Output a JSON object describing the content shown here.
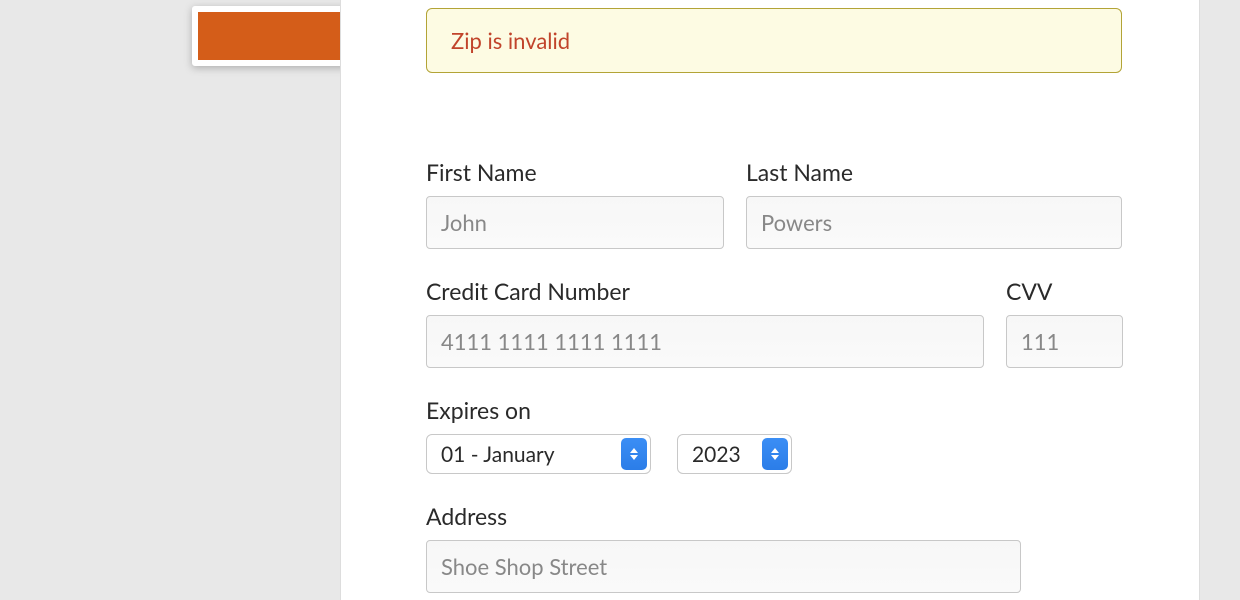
{
  "error": {
    "message": "Zip is invalid"
  },
  "form": {
    "first_name": {
      "label": "First Name",
      "value": "John"
    },
    "last_name": {
      "label": "Last Name",
      "value": "Powers"
    },
    "credit_card": {
      "label": "Credit Card Number",
      "value": "4111 1111 1111 1111"
    },
    "cvv": {
      "label": "CVV",
      "value": "111"
    },
    "expires": {
      "label": "Expires on",
      "month": "01 - January",
      "year": "2023"
    },
    "address": {
      "label": "Address",
      "value": "Shoe Shop Street"
    }
  }
}
